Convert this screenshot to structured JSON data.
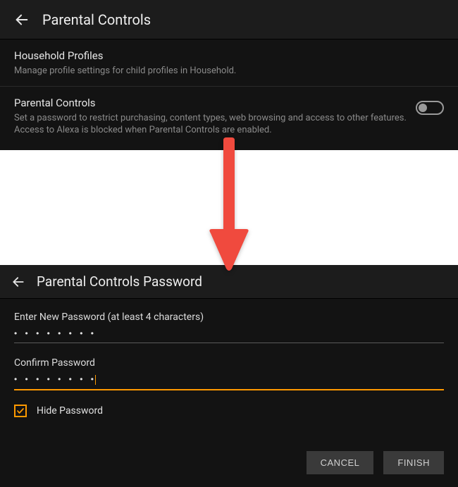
{
  "top": {
    "title": "Parental Controls",
    "household": {
      "title": "Household Profiles",
      "desc": "Manage profile settings for child profiles in Household."
    },
    "parental": {
      "title": "Parental Controls",
      "desc": "Set a password to restrict purchasing, content types, web browsing and access to other features. Access to Alexa is blocked when Parental Controls are enabled.",
      "toggle_state": "off"
    }
  },
  "bottom": {
    "title": "Parental Controls Password",
    "new_pw_label": "Enter New Password (at least 4 characters)",
    "new_pw_masked": "• • • • • • • •",
    "confirm_label": "Confirm Password",
    "confirm_masked": "• • • • • • • •",
    "hide_label": "Hide Password",
    "hide_checked": true,
    "cancel": "CANCEL",
    "finish": "FINISH"
  },
  "colors": {
    "accent": "#ff9900",
    "arrow": "#f04a3e"
  }
}
